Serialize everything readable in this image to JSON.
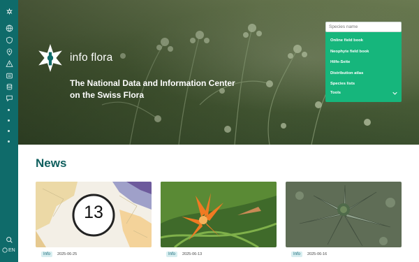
{
  "brand": {
    "name": "info flora"
  },
  "hero": {
    "tagline": "The National Data and Information Center on the Swiss Flora"
  },
  "search": {
    "placeholder": "Species name"
  },
  "menu": [
    "Online field book",
    "Neophyte field book",
    "Hilfe-Seite",
    "Distribution atlas",
    "Species lists"
  ],
  "tools": {
    "label": "Tools"
  },
  "news": {
    "title": "News",
    "cards": [
      {
        "tag": "Info",
        "date": "2025-06-25",
        "badge_number": "13"
      },
      {
        "tag": "Info",
        "date": "2025-06-13"
      },
      {
        "tag": "Info",
        "date": "2025-06-16"
      }
    ]
  },
  "rail": {
    "icons": [
      "logo-icon",
      "globe-icon",
      "shield-icon",
      "pin-icon",
      "warning-icon",
      "list-icon",
      "database-icon",
      "chat-icon"
    ],
    "language": "EN"
  },
  "colors": {
    "rail": "#0f6b6a",
    "panel": "#16b67c",
    "heading": "#0f5f5e",
    "tag_bg": "#d7eef0"
  }
}
